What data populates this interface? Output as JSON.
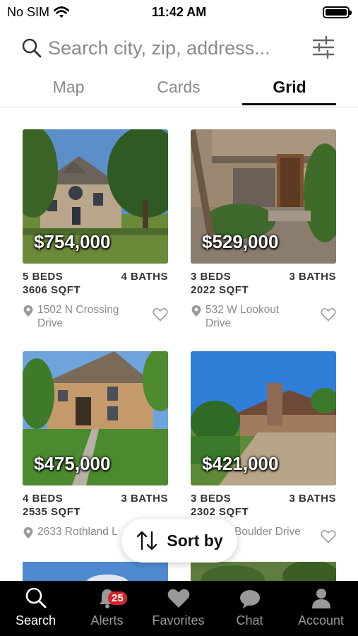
{
  "status_bar": {
    "carrier": "No SIM",
    "time": "11:42 AM"
  },
  "search": {
    "placeholder": "Search city, zip, address..."
  },
  "tabs": [
    {
      "label": "Map",
      "active": false
    },
    {
      "label": "Cards",
      "active": false
    },
    {
      "label": "Grid",
      "active": true
    }
  ],
  "listings": [
    {
      "price": "$754,000",
      "beds": "5 BEDS",
      "baths": "4 BATHS",
      "sqft": "3606 SQFT",
      "address": "1502 N Crossing Drive"
    },
    {
      "price": "$529,000",
      "beds": "3 BEDS",
      "baths": "3 BATHS",
      "sqft": "2022 SQFT",
      "address": "532 W Lookout Drive"
    },
    {
      "price": "$475,000",
      "beds": "4 BEDS",
      "baths": "3 BATHS",
      "sqft": "2535 SQFT",
      "address": "2633 Rothland L"
    },
    {
      "price": "$421,000",
      "beds": "3 BEDS",
      "baths": "3 BATHS",
      "sqft": "2302 SQFT",
      "address": "Boulder Drive"
    }
  ],
  "sort": {
    "label": "Sort by"
  },
  "tab_bar": [
    {
      "label": "Search",
      "icon": "search-icon",
      "active": true
    },
    {
      "label": "Alerts",
      "icon": "bell-icon",
      "active": false,
      "badge": "25"
    },
    {
      "label": "Favorites",
      "icon": "heart-icon",
      "active": false
    },
    {
      "label": "Chat",
      "icon": "chat-icon",
      "active": false
    },
    {
      "label": "Account",
      "icon": "person-icon",
      "active": false
    }
  ],
  "colors": {
    "accent": "#111111",
    "badge": "#d3262c",
    "tab_bar_bg": "#000000"
  }
}
